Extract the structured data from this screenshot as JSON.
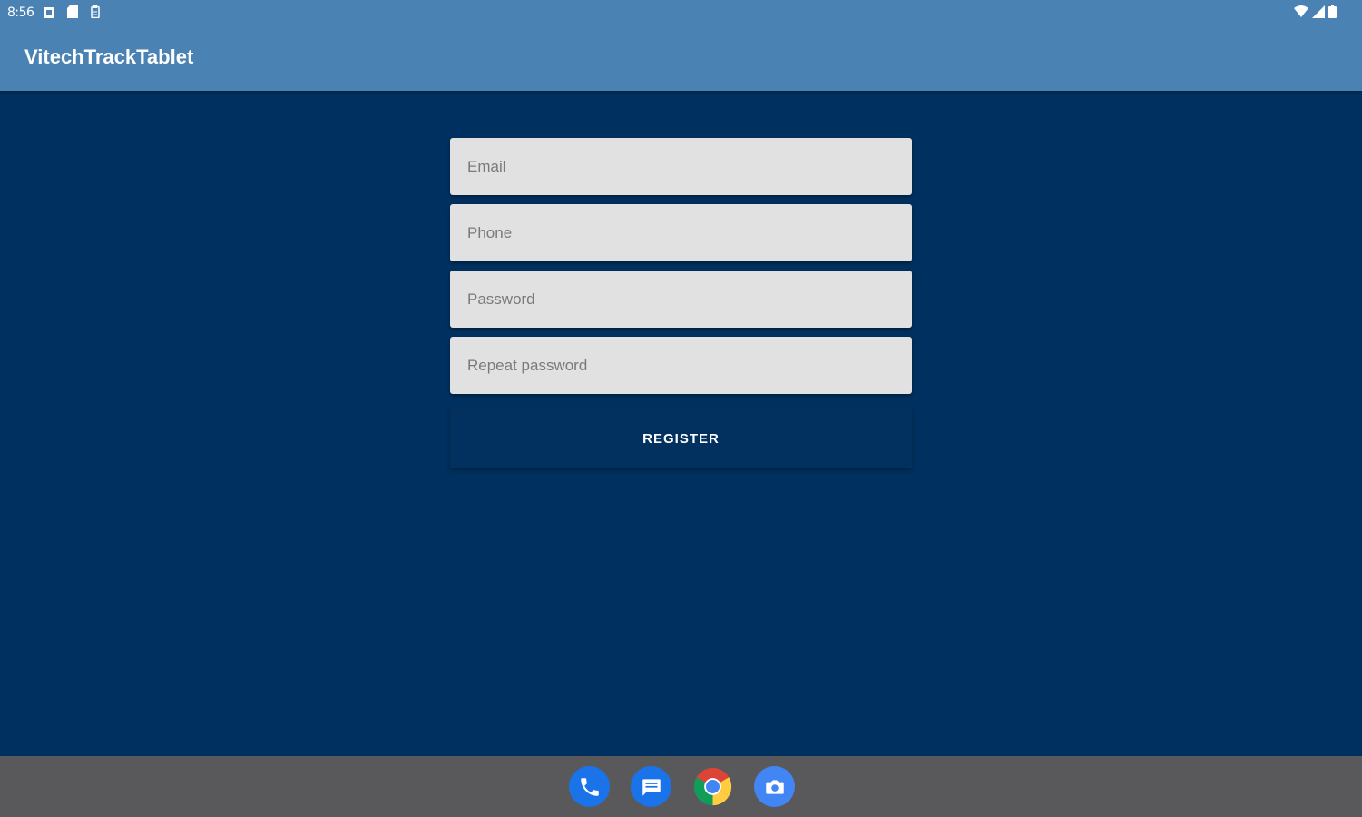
{
  "status_bar": {
    "time": "8:56",
    "left_icons": [
      "notification-icon",
      "sd-card-icon",
      "clipboard-icon"
    ],
    "right_icons": [
      "wifi-icon",
      "signal-icon",
      "battery-icon"
    ]
  },
  "app_bar": {
    "title": "VitechTrackTablet",
    "color": "#4a82b4"
  },
  "form": {
    "email": {
      "placeholder": "Email",
      "value": ""
    },
    "phone": {
      "placeholder": "Phone",
      "value": ""
    },
    "password": {
      "placeholder": "Password",
      "value": ""
    },
    "repeat_password": {
      "placeholder": "Repeat password",
      "value": ""
    },
    "register_label": "REGISTER"
  },
  "nav_bar": {
    "dock_apps": [
      "phone-icon",
      "messages-icon",
      "chrome-icon",
      "camera-icon"
    ]
  },
  "colors": {
    "background": "#00305f",
    "field": "#e1e1e1",
    "nav_bar": "#59595b"
  }
}
